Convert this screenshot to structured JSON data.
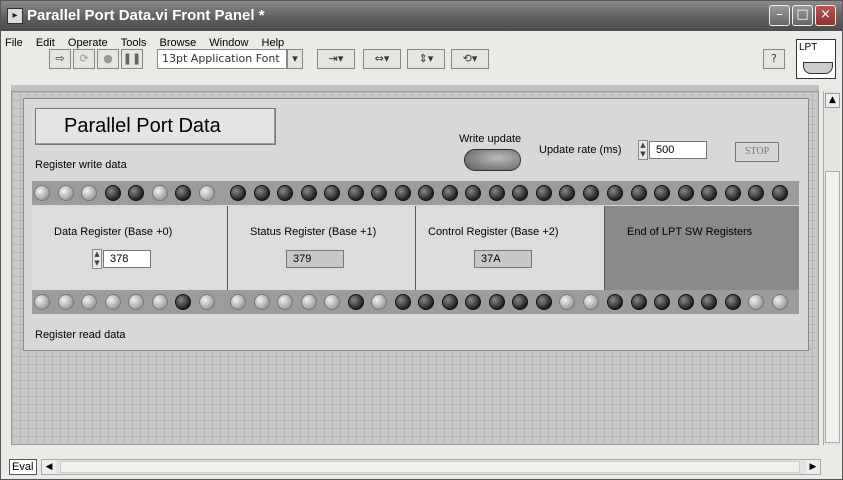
{
  "window": {
    "title": "Parallel Port Data.vi Front Panel *",
    "vi_icon_label": "LPT"
  },
  "menu": [
    "File",
    "Edit",
    "Operate",
    "Tools",
    "Browse",
    "Window",
    "Help"
  ],
  "toolbar": {
    "font_select": "13pt Application Font",
    "help_label": "?"
  },
  "panel": {
    "title": "Parallel Port Data",
    "write_update_label": "Write update",
    "update_rate_label": "Update rate (ms)",
    "update_rate_value": "500",
    "stop_label": "STOP",
    "register_write_label": "Register write data",
    "register_read_label": "Register read data"
  },
  "registers": [
    {
      "label": "Data Register (Base +0)",
      "value": "378"
    },
    {
      "label": "Status Register (Base +1)",
      "value": "379"
    },
    {
      "label": "Control Register (Base +2)",
      "value": "37A"
    },
    {
      "label": "End of LPT SW Registers"
    }
  ],
  "leds": {
    "write_row": [
      [
        0,
        0,
        0,
        1,
        1,
        0,
        1,
        0
      ],
      [
        1,
        1,
        1,
        1,
        1,
        1,
        1,
        1
      ],
      [
        1,
        1,
        1,
        1,
        1,
        1,
        1,
        1
      ],
      [
        1,
        1,
        1,
        1,
        1,
        1,
        1,
        1
      ]
    ],
    "read_row": [
      [
        0,
        0,
        0,
        0,
        0,
        0,
        1,
        0
      ],
      [
        0,
        0,
        0,
        0,
        0,
        1,
        0,
        1
      ],
      [
        1,
        1,
        1,
        1,
        1,
        1,
        0,
        0
      ],
      [
        1,
        1,
        1,
        1,
        1,
        1,
        0,
        0
      ]
    ]
  },
  "statusbar": {
    "eval_label": "Eval"
  },
  "colors": {
    "titlebar": "#5f5f5f",
    "panel_bg": "#d8d8d8",
    "end_registers_bg": "#8a8a8a"
  }
}
